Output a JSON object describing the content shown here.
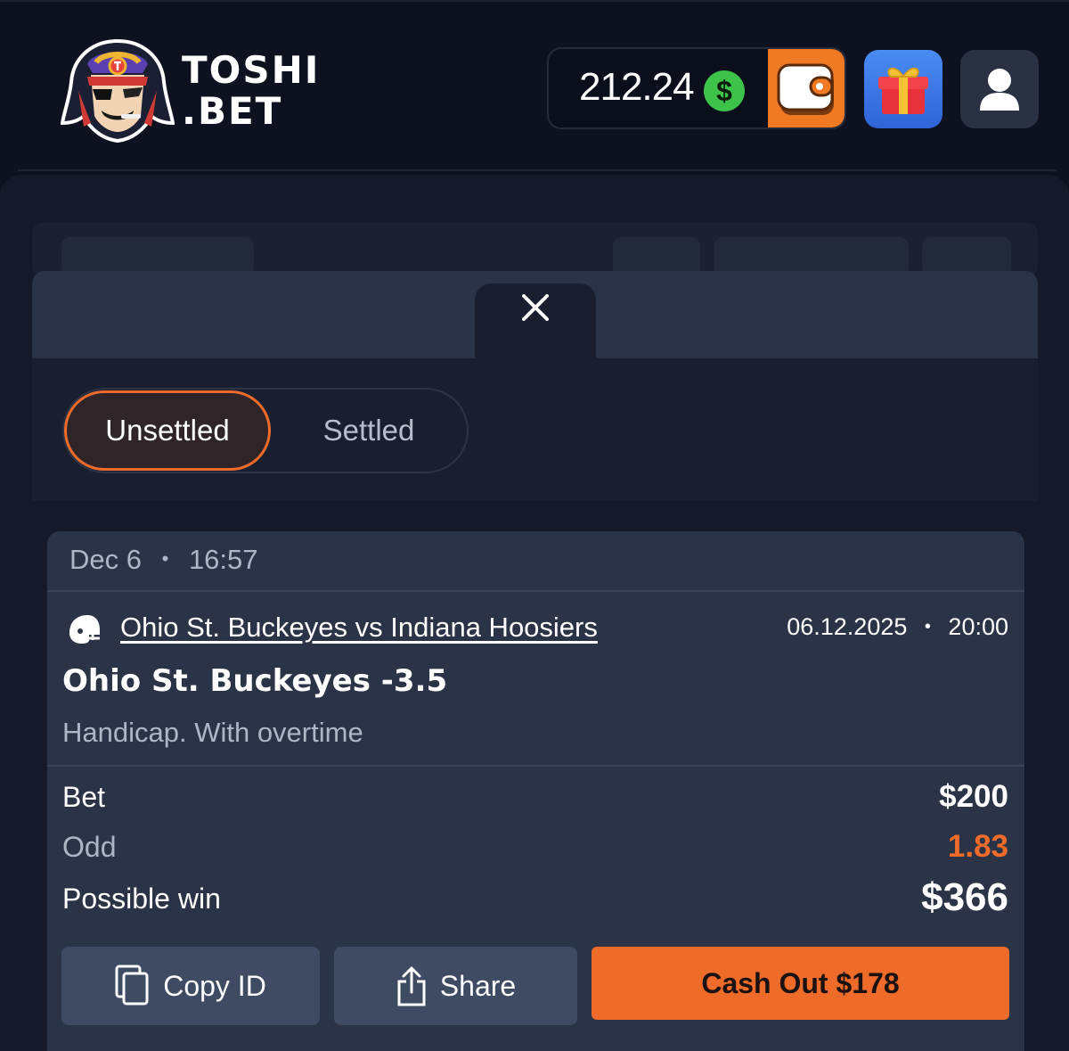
{
  "header": {
    "brand_line1": "TOSHI",
    "brand_line2": ".BET",
    "balance": "212.24",
    "currency_symbol": "$",
    "wallet_icon": "wallet-icon",
    "gift_icon": "gift-icon",
    "user_icon": "user-icon"
  },
  "modal": {
    "close_icon": "close-icon",
    "tabs": [
      {
        "label": "Unsettled",
        "active": true
      },
      {
        "label": "Settled",
        "active": false
      }
    ]
  },
  "bet": {
    "date": "Dec 6",
    "time": "16:57",
    "sport_icon": "football-helmet-icon",
    "match": "Ohio St. Buckeyes vs Indiana Hoosiers",
    "match_date": "06.12.2025",
    "match_time": "20:00",
    "selection": "Ohio St. Buckeyes -3.5",
    "market": "Handicap. With overtime",
    "rows": {
      "bet_label": "Bet",
      "bet_value": "$200",
      "odd_label": "Odd",
      "odd_value": "1.83",
      "win_label": "Possible win",
      "win_value": "$366"
    },
    "actions": {
      "copy_label": "Copy ID",
      "share_label": "Share",
      "cashout_label": "Cash Out $178"
    }
  },
  "colors": {
    "accent": "#ef6b2a",
    "background": "#0d1120",
    "card": "#2b3346",
    "positive": "#3dc34a"
  }
}
